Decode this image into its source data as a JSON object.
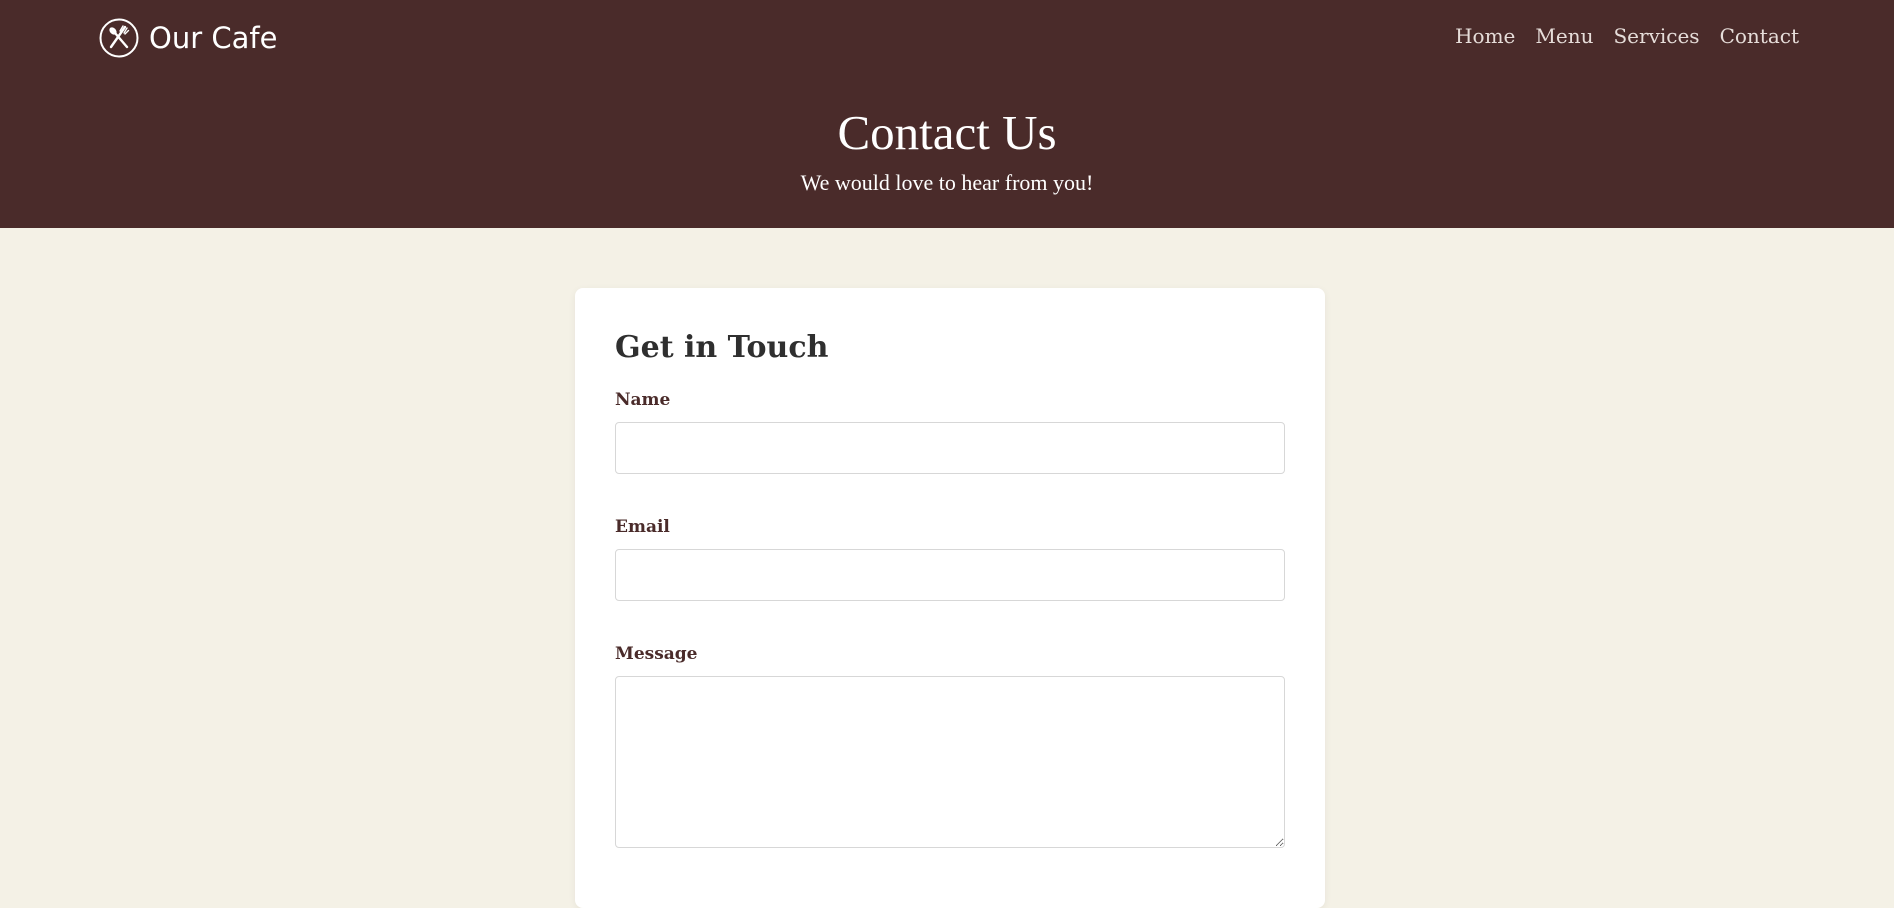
{
  "brand": {
    "name": "Our Cafe",
    "icon": "utensils-icon"
  },
  "nav": {
    "items": [
      {
        "label": "Home"
      },
      {
        "label": "Menu"
      },
      {
        "label": "Services"
      },
      {
        "label": "Contact"
      }
    ]
  },
  "hero": {
    "title": "Contact Us",
    "subtitle": "We would love to hear from you!"
  },
  "form": {
    "title": "Get in Touch",
    "name_label": "Name",
    "name_value": "",
    "name_placeholder": "",
    "email_label": "Email",
    "email_value": "",
    "email_placeholder": "",
    "message_label": "Message",
    "message_value": "",
    "message_placeholder": ""
  },
  "colors": {
    "header_bg": "#4a2b2a",
    "page_bg": "#f4f1e6",
    "card_bg": "#ffffff",
    "label_color": "#4a2b2a",
    "heading_color": "#2f2f2f"
  }
}
